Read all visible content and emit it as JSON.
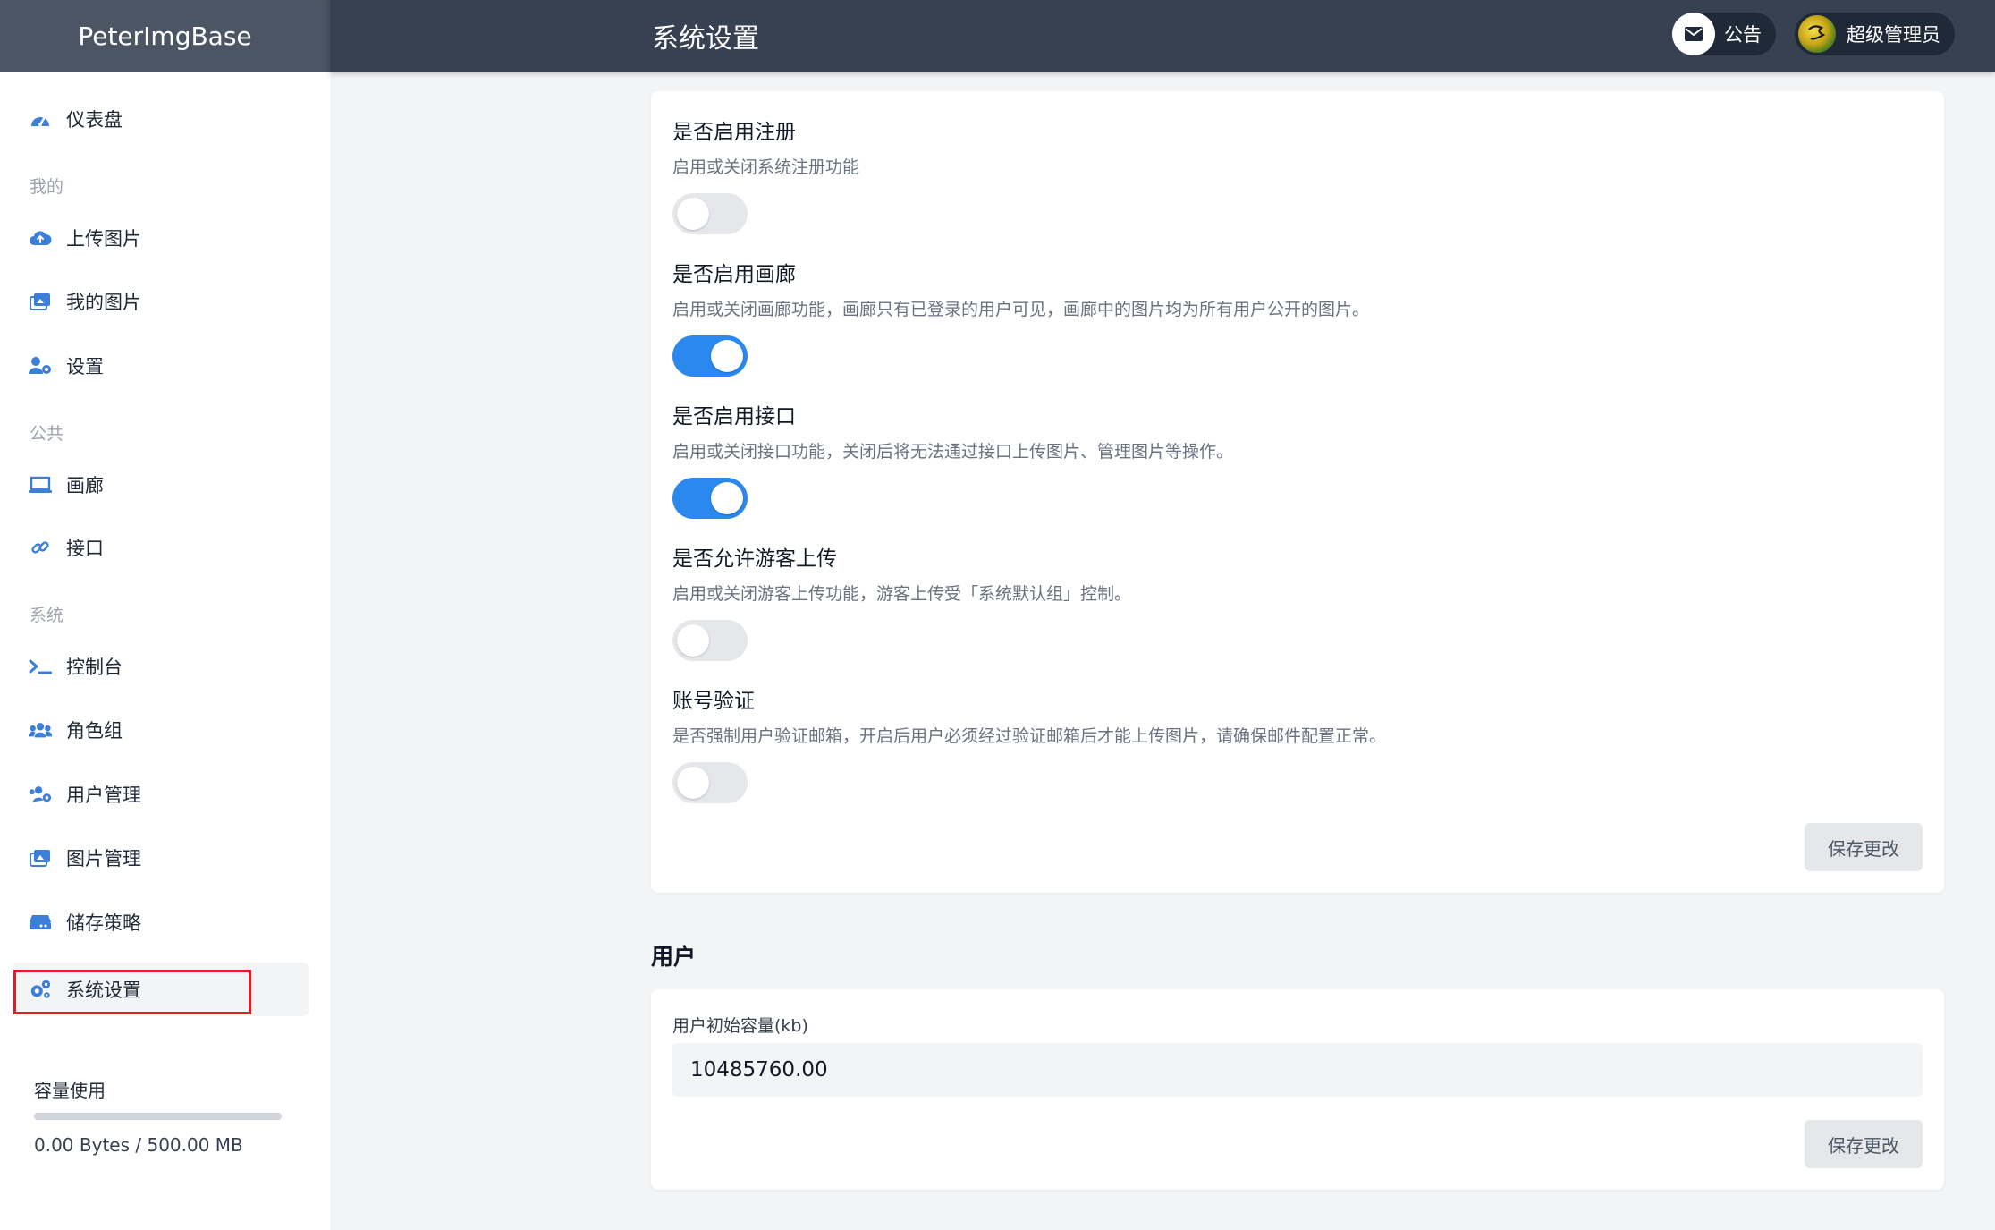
{
  "app": {
    "brand": "PeterImgBase"
  },
  "header": {
    "title": "系统设置",
    "notice_label": "公告",
    "user_label": "超级管理员"
  },
  "sidebar": {
    "dashboard": "仪表盘",
    "section_mine": "我的",
    "upload": "上传图片",
    "my_images": "我的图片",
    "settings": "设置",
    "section_public": "公共",
    "gallery": "画廊",
    "api": "接口",
    "section_system": "系统",
    "console": "控制台",
    "role_groups": "角色组",
    "user_management": "用户管理",
    "image_management": "图片管理",
    "storage_strategy": "储存策略",
    "system_settings": "系统设置",
    "usage_label": "容量使用",
    "usage_text": "0.00 Bytes / 500.00 MB",
    "usage_fraction": 0
  },
  "settings": [
    {
      "title": "是否启用注册",
      "desc": "启用或关闭系统注册功能",
      "enabled": false
    },
    {
      "title": "是否启用画廊",
      "desc": "启用或关闭画廊功能，画廊只有已登录的用户可见，画廊中的图片均为所有用户公开的图片。",
      "enabled": true
    },
    {
      "title": "是否启用接口",
      "desc": "启用或关闭接口功能，关闭后将无法通过接口上传图片、管理图片等操作。",
      "enabled": true
    },
    {
      "title": "是否允许游客上传",
      "desc": "启用或关闭游客上传功能，游客上传受「系统默认组」控制。",
      "enabled": false
    },
    {
      "title": "账号验证",
      "desc": "是否强制用户验证邮箱，开启后用户必须经过验证邮箱后才能上传图片，请确保邮件配置正常。",
      "enabled": false
    }
  ],
  "save_label": "保存更改",
  "user_section": {
    "heading": "用户",
    "field_label": "用户初始容量(kb)",
    "field_value": "10485760.00"
  },
  "colors": {
    "toggle_on": "#2b88ee",
    "header_bg": "#374151",
    "active_highlight": "#e11d2a"
  }
}
